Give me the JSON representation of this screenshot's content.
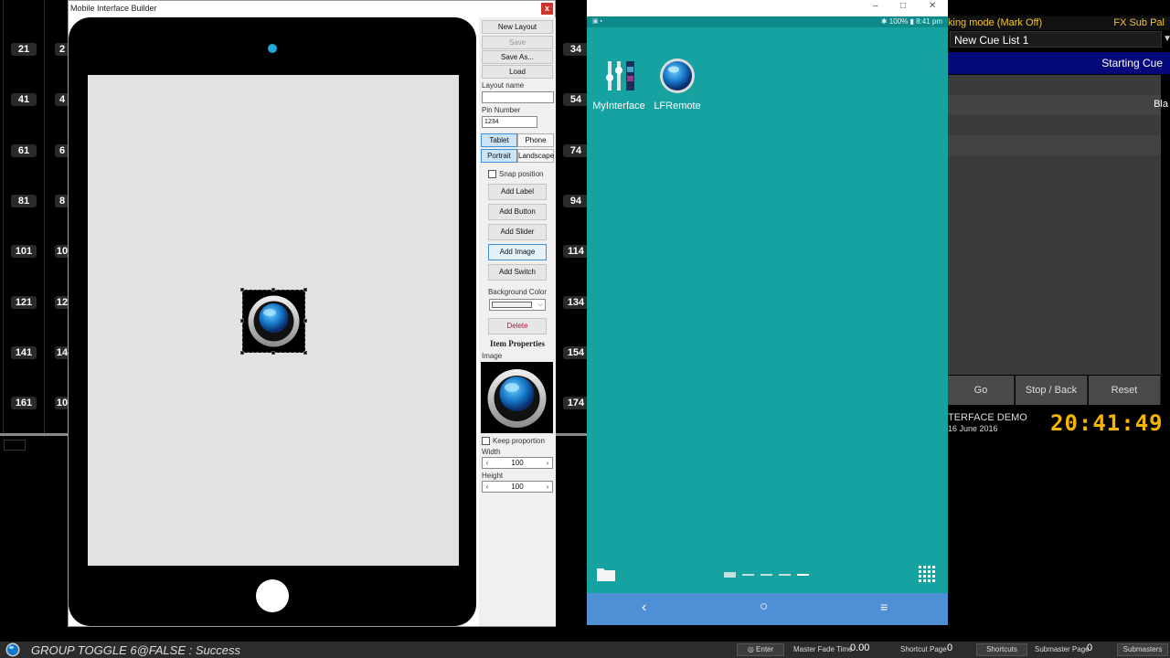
{
  "background_console": {
    "left_labels": [
      "21",
      "41",
      "61",
      "81",
      "101",
      "121",
      "141",
      "161"
    ],
    "left_partial_labels": [
      "2",
      "4",
      "6",
      "8",
      "10",
      "12",
      "14",
      "10"
    ],
    "middle_labels": [
      "34",
      "54",
      "74",
      "94",
      "114",
      "134",
      "154",
      "174"
    ]
  },
  "builder": {
    "title": "Mobile Interface Builder",
    "close_label": "x",
    "buttons": {
      "new_layout": "New Layout",
      "save": "Save",
      "save_as": "Save As...",
      "load": "Load"
    },
    "layout_name_label": "Layout name",
    "layout_name_value": "",
    "pin_number_label": "Pin Number",
    "pin_number_value": "1234",
    "device_toggle": {
      "tablet": "Tablet",
      "phone": "Phone",
      "selected": "Tablet"
    },
    "orientation_toggle": {
      "portrait": "Portrait",
      "landscape": "Landscape",
      "selected": "Portrait"
    },
    "snap_position_label": "Snap position",
    "snap_position_checked": false,
    "add_buttons": {
      "add_label": "Add Label",
      "add_button": "Add Button",
      "add_slider": "Add Slider",
      "add_image": "Add Image",
      "add_switch": "Add Switch"
    },
    "background_color_label": "Background Color",
    "delete_label": "Delete",
    "item_properties_title": "Item Properties",
    "image_label": "Image",
    "keep_proportion_label": "Keep proportion",
    "keep_proportion_checked": false,
    "width_label": "Width",
    "width_value": "100",
    "height_label": "Height",
    "height_value": "100",
    "colors": {
      "camera": "#21a7da",
      "delete_text": "#c8102e"
    }
  },
  "emulator": {
    "status_time": "8:41 pm",
    "status_battery": "100%",
    "apps": [
      {
        "label": "MyInterface",
        "icon": "sliders-icon"
      },
      {
        "label": "LFRemote",
        "icon": "globe-icon"
      }
    ],
    "colors": {
      "screen": "#16a2a0",
      "navbar": "#4e8fd6"
    }
  },
  "right_console": {
    "tracking_mode": "king mode (Mark Off)",
    "fx_sub": "FX Sub Pal",
    "cue_list": "New Cue List 1",
    "starting_cue": "Starting Cue",
    "partial_text": "Bla",
    "buttons": {
      "go": "Go",
      "stop_back": "Stop / Back",
      "reset": "Reset"
    },
    "show_name": "TERFACE DEMO",
    "show_date": "16 June  2016",
    "clock": "20:41:49"
  },
  "statusbar": {
    "message": "GROUP TOGGLE 6@FALSE : Success",
    "enter_label": "Enter",
    "master_fade_label": "Master Fade Time",
    "master_fade_value": "0.00",
    "shortcut_page_label": "Shortcut Page",
    "shortcut_page_value": "0",
    "shortcuts_label": "Shortcuts",
    "submaster_page_label": "Submaster Page",
    "submaster_page_value": "0",
    "submasters_label": "Submasters"
  }
}
